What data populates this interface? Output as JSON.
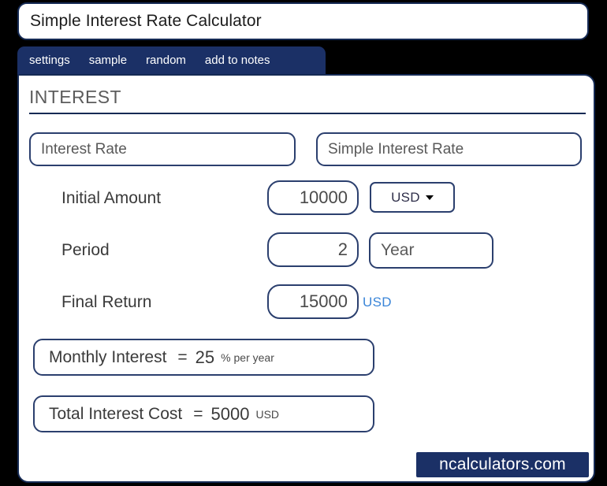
{
  "window": {
    "title": "Simple Interest Rate Calculator"
  },
  "tabs": [
    {
      "label": "settings"
    },
    {
      "label": "sample"
    },
    {
      "label": "random"
    },
    {
      "label": "add to notes"
    }
  ],
  "panel": {
    "section_title": "INTEREST",
    "calc_type_field": {
      "value": "Interest Rate"
    },
    "calc_mode_field": {
      "value": "Simple Interest Rate"
    },
    "rows": [
      {
        "label": "Initial Amount",
        "value": "10000",
        "unit": "USD",
        "unit_kind": "select"
      },
      {
        "label": "Period",
        "value": "2",
        "unit": "Year",
        "unit_kind": "text-box"
      },
      {
        "label": "Final Return",
        "value": "15000",
        "unit": "USD",
        "unit_kind": "plain-label"
      }
    ],
    "results": [
      {
        "label": "Monthly Interest",
        "equals": "=",
        "value": "25",
        "unit": "% per year"
      },
      {
        "label": "Total Interest Cost",
        "equals": "=",
        "value": "5000",
        "unit": "USD"
      }
    ]
  },
  "watermark": {
    "text": "ncalculators.com"
  },
  "colors": {
    "page_background": "#000000",
    "navy_border": "#152a54",
    "tab_navy": "#1b3066",
    "field_border": "#2b3f6e",
    "label_text": "#3a3a3a",
    "muted_text": "#5c5c5c",
    "accent_blue": "#3a85d8"
  }
}
